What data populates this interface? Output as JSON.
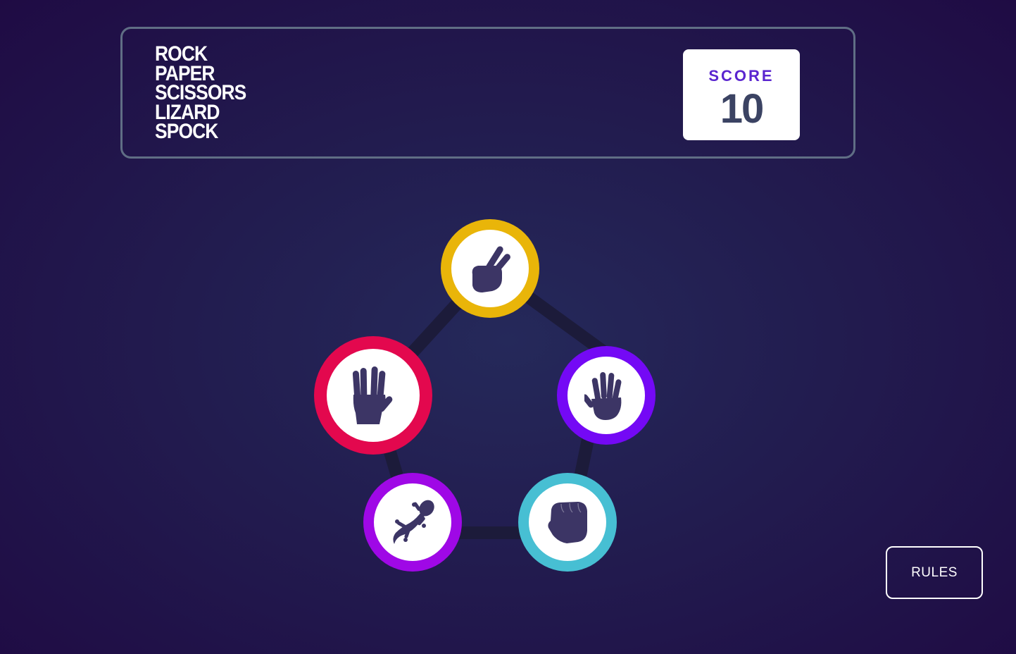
{
  "header": {
    "title_lines": [
      "ROCK",
      "PAPER",
      "SCISSORS",
      "LIZARD",
      "SPOCK"
    ],
    "score_label": "SCORE",
    "score_value": "10"
  },
  "choices": [
    {
      "id": "scissors",
      "icon": "scissors-hand-icon",
      "ring_color": "#e9b509"
    },
    {
      "id": "paper",
      "icon": "paper-hand-icon",
      "ring_color": "#7409f5"
    },
    {
      "id": "rock",
      "icon": "rock-fist-icon",
      "ring_color": "#47bfd3"
    },
    {
      "id": "lizard",
      "icon": "lizard-icon",
      "ring_color": "#9f08e6"
    },
    {
      "id": "spock",
      "icon": "spock-hand-icon",
      "ring_color": "#e3084e"
    }
  ],
  "rules_button": {
    "label": "RULES"
  },
  "colors": {
    "background_center": "#25295a",
    "background_edge": "#1f0b44",
    "header_border": "#606e85",
    "score_label": "#5a25cf",
    "score_value": "#3b4363",
    "icon_fill": "#3c3565",
    "pentagon_line": "#1c1b3a"
  }
}
